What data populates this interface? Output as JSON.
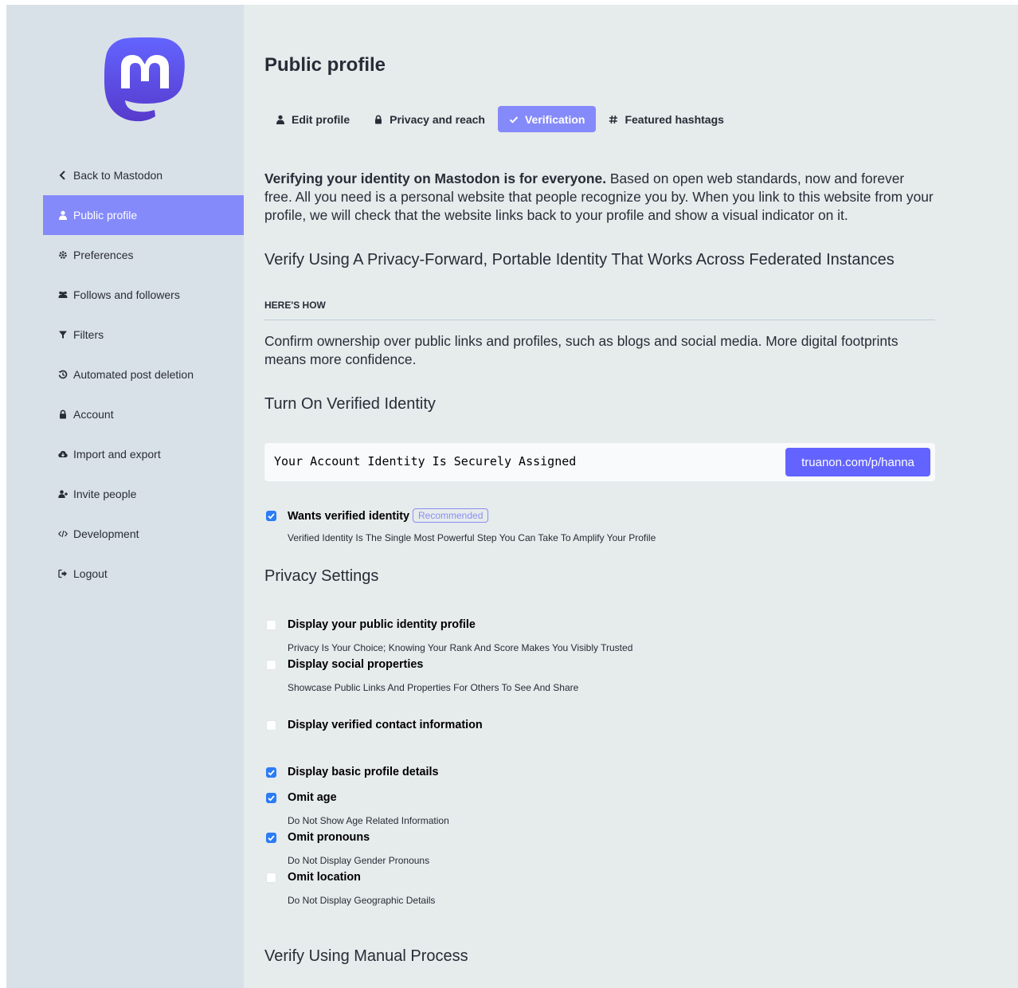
{
  "colors": {
    "accent": "#858afa",
    "button": "#6364ff",
    "checkbox": "#2b7cf6",
    "sidebar_bg": "#d9e1e8",
    "content_bg": "#e6ebec"
  },
  "logo": {
    "icon": "mastodon-logo-icon"
  },
  "sidebar": {
    "items": [
      {
        "label": "Back to Mastodon",
        "icon": "chevron-left-icon",
        "active": false
      },
      {
        "label": "Public profile",
        "icon": "user-icon",
        "active": true
      },
      {
        "label": "Preferences",
        "icon": "gear-icon",
        "active": false
      },
      {
        "label": "Follows and followers",
        "icon": "users-icon",
        "active": false
      },
      {
        "label": "Filters",
        "icon": "filter-icon",
        "active": false
      },
      {
        "label": "Automated post deletion",
        "icon": "history-icon",
        "active": false
      },
      {
        "label": "Account",
        "icon": "lock-icon",
        "active": false
      },
      {
        "label": "Import and export",
        "icon": "cloud-download-icon",
        "active": false
      },
      {
        "label": "Invite people",
        "icon": "user-plus-icon",
        "active": false
      },
      {
        "label": "Development",
        "icon": "code-icon",
        "active": false
      },
      {
        "label": "Logout",
        "icon": "sign-out-icon",
        "active": false
      }
    ]
  },
  "header": {
    "title": "Public profile"
  },
  "tabs": [
    {
      "label": "Edit profile",
      "icon": "user-icon",
      "active": false
    },
    {
      "label": "Privacy and reach",
      "icon": "lock-icon",
      "active": false
    },
    {
      "label": "Verification",
      "icon": "check-icon",
      "active": true
    },
    {
      "label": "Featured hashtags",
      "icon": "hashtag-icon",
      "active": false
    }
  ],
  "intro": {
    "bold": "Verifying your identity on Mastodon is for everyone.",
    "rest": " Based on open web standards, now and forever free. All you need is a personal website that people recognize you by. When you link to this website from your profile, we will check that the website links back to your profile and show a visual indicator on it."
  },
  "section_portable": "Verify Using A Privacy-Forward, Portable Identity That Works Across Federated Instances",
  "howto": {
    "heading": "HERE'S HOW",
    "text": "Confirm ownership over public links and profiles, such as blogs and social media. More digital footprints means more confidence."
  },
  "turn_on": {
    "heading": "Turn On Verified Identity",
    "identity_text": "Your Account Identity Is Securely Assigned",
    "identity_link": "truanon.com/p/hanna",
    "wants": {
      "label": "Wants verified identity",
      "badge": "Recommended",
      "hint": "Verified Identity Is The Single Most Powerful Step You Can Take To Amplify Your Profile",
      "checked": true
    }
  },
  "privacy": {
    "heading": "Privacy Settings",
    "options": [
      {
        "label": "Display your public identity profile",
        "hint": "Privacy Is Your Choice; Knowing Your Rank And Score Makes You Visibly Trusted",
        "checked": false
      },
      {
        "label": "Display social properties",
        "hint": "Showcase Public Links And Properties For Others To See And Share",
        "checked": false
      },
      {
        "label": "Display verified contact information",
        "hint": "",
        "checked": false
      },
      {
        "label": "Display basic profile details",
        "hint": "",
        "checked": true
      },
      {
        "label": "Omit age",
        "hint": "Do Not Show Age Related Information",
        "checked": true
      },
      {
        "label": "Omit pronouns",
        "hint": "Do Not Display Gender Pronouns",
        "checked": true
      },
      {
        "label": "Omit location",
        "hint": "Do Not Display Geographic Details",
        "checked": false
      }
    ]
  },
  "manual": {
    "heading": "Verify Using Manual Process"
  }
}
